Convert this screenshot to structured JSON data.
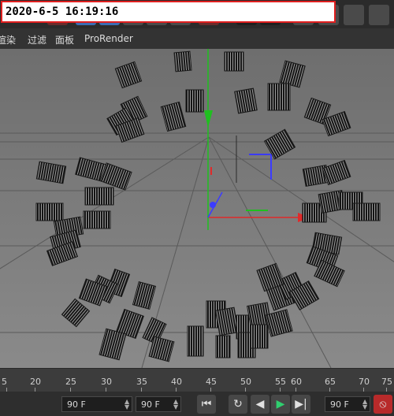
{
  "overlay": {
    "timestamp": "2020-6-5 16:19:16"
  },
  "menu": {
    "items": [
      "渲染",
      "过滤",
      "面板",
      "ProRender"
    ]
  },
  "timeline": {
    "ticks": [
      "5",
      "20",
      "25",
      "30",
      "35",
      "40",
      "45",
      "50",
      "55",
      "60",
      "65",
      "70",
      "75"
    ]
  },
  "bottom": {
    "left_frame": "90 F",
    "mid_frame": "90 F",
    "right_frame": "90 F"
  },
  "colors": {
    "x_axis": "#e02a2a",
    "y_axis": "#1fc01f",
    "z_axis": "#3b3bff",
    "timestamp_border": "#e01f1f"
  }
}
